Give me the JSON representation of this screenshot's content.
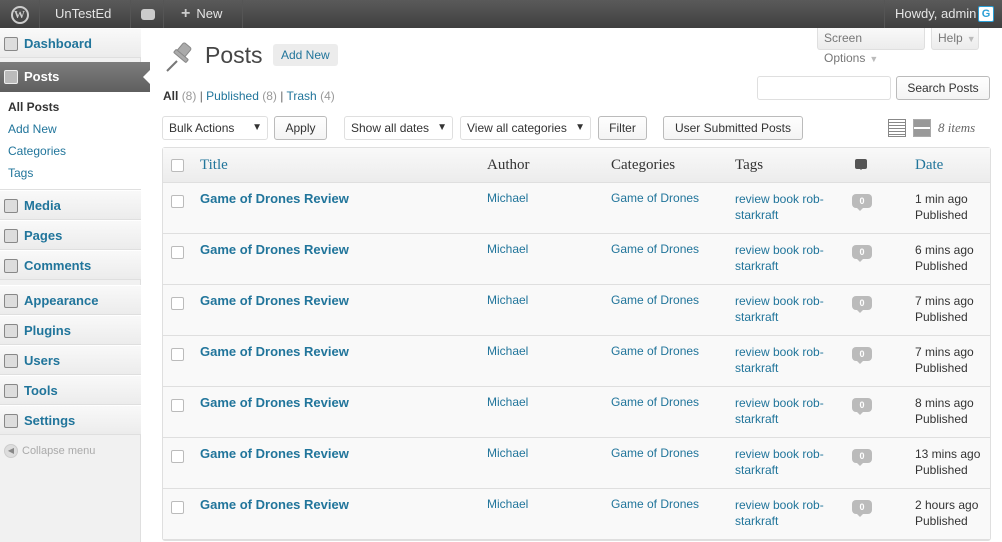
{
  "adminbar": {
    "site_name": "UnTestEd",
    "new_label": "New",
    "account": "Howdy, admin"
  },
  "menu": {
    "dashboard": "Dashboard",
    "posts": "Posts",
    "posts_sub": [
      "All Posts",
      "Add New",
      "Categories",
      "Tags"
    ],
    "media": "Media",
    "pages": "Pages",
    "comments": "Comments",
    "appearance": "Appearance",
    "plugins": "Plugins",
    "users": "Users",
    "tools": "Tools",
    "settings": "Settings",
    "collapse": "Collapse menu"
  },
  "header": {
    "screen_options": "Screen Options",
    "help": "Help",
    "title": "Posts",
    "add_new": "Add New"
  },
  "filters": {
    "all": "All",
    "all_count": "(8)",
    "published": "Published",
    "published_count": "(8)",
    "trash": "Trash",
    "trash_count": "(4)",
    "sep": "|"
  },
  "search": {
    "placeholder": "",
    "button": "Search Posts"
  },
  "toolbar": {
    "bulk_actions": "Bulk Actions",
    "apply": "Apply",
    "dates": "Show all dates",
    "categories": "View all categories",
    "filter": "Filter",
    "user_submitted": "User Submitted Posts",
    "items_count": "8 items"
  },
  "table": {
    "columns": {
      "title": "Title",
      "author": "Author",
      "categories": "Categories",
      "tags": "Tags",
      "date": "Date"
    },
    "rows": [
      {
        "title": "Game of Drones Review",
        "author": "Michael",
        "category": "Game of Drones",
        "tags": "review book rob-starkraft",
        "comments": "0",
        "date": "1 min ago",
        "status": "Published"
      },
      {
        "title": "Game of Drones Review",
        "author": "Michael",
        "category": "Game of Drones",
        "tags": "review book rob-starkraft",
        "comments": "0",
        "date": "6 mins ago",
        "status": "Published"
      },
      {
        "title": "Game of Drones Review",
        "author": "Michael",
        "category": "Game of Drones",
        "tags": "review book rob-starkraft",
        "comments": "0",
        "date": "7 mins ago",
        "status": "Published"
      },
      {
        "title": "Game of Drones Review",
        "author": "Michael",
        "category": "Game of Drones",
        "tags": "review book rob-starkraft",
        "comments": "0",
        "date": "7 mins ago",
        "status": "Published"
      },
      {
        "title": "Game of Drones Review",
        "author": "Michael",
        "category": "Game of Drones",
        "tags": "review book rob-starkraft",
        "comments": "0",
        "date": "8 mins ago",
        "status": "Published"
      },
      {
        "title": "Game of Drones Review",
        "author": "Michael",
        "category": "Game of Drones",
        "tags": "review book rob-starkraft",
        "comments": "0",
        "date": "13 mins ago",
        "status": "Published"
      },
      {
        "title": "Game of Drones Review",
        "author": "Michael",
        "category": "Game of Drones",
        "tags": "review book rob-starkraft",
        "comments": "0",
        "date": "2 hours ago",
        "status": "Published"
      }
    ]
  }
}
